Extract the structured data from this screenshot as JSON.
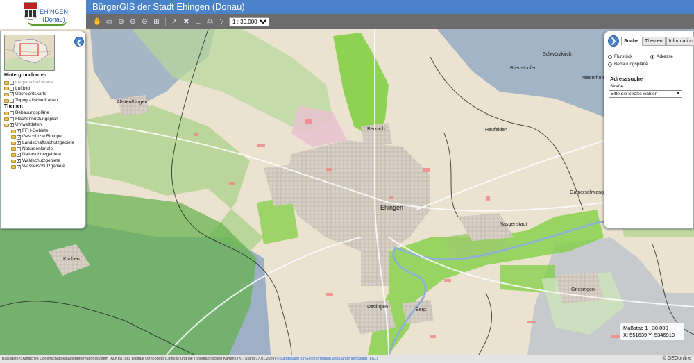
{
  "header": {
    "logo_town": "EHINGEN",
    "logo_region": "(Donau)",
    "title": "BürgerGIS der Stadt Ehingen (Donau)"
  },
  "toolbar": {
    "icons": [
      "hand-pan",
      "info",
      "zoom-in",
      "zoom-out",
      "zoom-full",
      "zoom-extent",
      "select-arrow",
      "select-clear",
      "measure",
      "print",
      "help"
    ],
    "scale_selected": "1 : 30.000"
  },
  "left_panel": {
    "background_head": "Hintergrundkarten",
    "background_items": [
      {
        "label": "Liegenschaftskarte",
        "checked": false,
        "disabled": true
      },
      {
        "label": "Luftbild",
        "checked": false,
        "disabled": false
      },
      {
        "label": "Übersichtskarte",
        "checked": true,
        "disabled": false
      },
      {
        "label": "Topografische Karten",
        "checked": false,
        "disabled": false
      }
    ],
    "themes_head": "Themen",
    "theme_items": [
      {
        "label": "Bebauungspläne",
        "checked": false,
        "level": 0
      },
      {
        "label": "Flächennutzungsplan",
        "checked": false,
        "level": 0
      },
      {
        "label": "Umweltdaten",
        "checked": true,
        "level": 0
      },
      {
        "label": "FFH-Gebiete",
        "checked": true,
        "level": 1
      },
      {
        "label": "Geschützte Biotope",
        "checked": true,
        "level": 1
      },
      {
        "label": "Landschaftsschutzgebiete",
        "checked": true,
        "level": 1
      },
      {
        "label": "Naturdenkmale",
        "checked": false,
        "level": 1
      },
      {
        "label": "Naturschutzgebiete",
        "checked": true,
        "level": 1
      },
      {
        "label": "Waldschutzgebiete",
        "checked": true,
        "level": 1
      },
      {
        "label": "Wasserschutzgebiete",
        "checked": true,
        "level": 1
      }
    ]
  },
  "right_panel": {
    "tabs": [
      "Suche",
      "Themen",
      "Information"
    ],
    "active_tab": "Suche",
    "search_options": [
      {
        "label": "Flurstück",
        "selected": false
      },
      {
        "label": "Adresse",
        "selected": true
      },
      {
        "label": "Bebauungspläne",
        "selected": false
      }
    ],
    "address_title": "Adresssuche",
    "street_label": "Straße",
    "street_placeholder": "Bitte die Straße wählen"
  },
  "map": {
    "places": [
      "Schwörzkirch",
      "Bliensthofen",
      "Niederhofen",
      "Altsteußlingen",
      "Berkach",
      "Heufelden",
      "Ehingen",
      "Gamerschwang",
      "Nasgenstadt",
      "Kirchen",
      "Dettingen",
      "Berg",
      "Griesingen"
    ],
    "scale_text": "Maßstab 1 : 30.000",
    "coords_text": "X: 551639 Y: 5346919"
  },
  "footer": {
    "attribution": "Basisdaten: Amtliches Liegenschaftskatasterinformationssystem (ALKIS), das Digitale Orthophoto (Luftbild) und die Topographischen Karten (TK) (Stand 17.01.2020)",
    "attribution_link": "© Landesamt für Geoinformation und Landentwicklung (LGL)",
    "brand": "© GEOonline"
  },
  "colors": {
    "title_bar": "#4a83c9",
    "toolbar": "#6c6c6c",
    "landscape_protection": "#9fcf7d",
    "nature_reserve": "#7ccf3c",
    "water_protection": "#8aa4c2",
    "biotope": "#f08a8a"
  }
}
